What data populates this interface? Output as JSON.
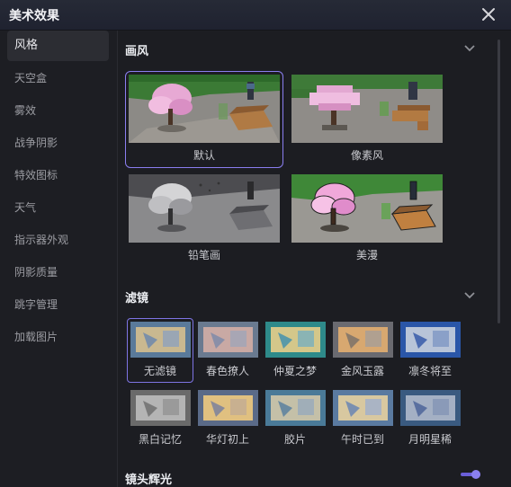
{
  "window": {
    "title": "美术效果"
  },
  "sidebar": {
    "items": [
      {
        "label": "风格",
        "active": true
      },
      {
        "label": "天空盒"
      },
      {
        "label": "雾效"
      },
      {
        "label": "战争阴影"
      },
      {
        "label": "特效图标"
      },
      {
        "label": "天气"
      },
      {
        "label": "指示器外观"
      },
      {
        "label": "阴影质量"
      },
      {
        "label": "跳字管理"
      },
      {
        "label": "加载图片"
      }
    ]
  },
  "art_style": {
    "title": "画风",
    "options": [
      {
        "label": "默认",
        "selected": true
      },
      {
        "label": "像素风"
      },
      {
        "label": "铅笔画"
      },
      {
        "label": "美漫"
      }
    ]
  },
  "filter": {
    "title": "滤镜",
    "options": [
      {
        "label": "无滤镜",
        "selected": true
      },
      {
        "label": "春色撩人"
      },
      {
        "label": "仲夏之梦"
      },
      {
        "label": "金风玉露"
      },
      {
        "label": "凛冬将至"
      },
      {
        "label": "黑白记忆"
      },
      {
        "label": "华灯初上"
      },
      {
        "label": "胶片"
      },
      {
        "label": "午时已到"
      },
      {
        "label": "月明星稀"
      }
    ]
  },
  "lens_flare": {
    "title": "镜头辉光",
    "enabled": true
  },
  "colors": {
    "accent": "#8a7ef0",
    "background": "#1c1d22",
    "sidebar_active": "#2c2d33"
  }
}
